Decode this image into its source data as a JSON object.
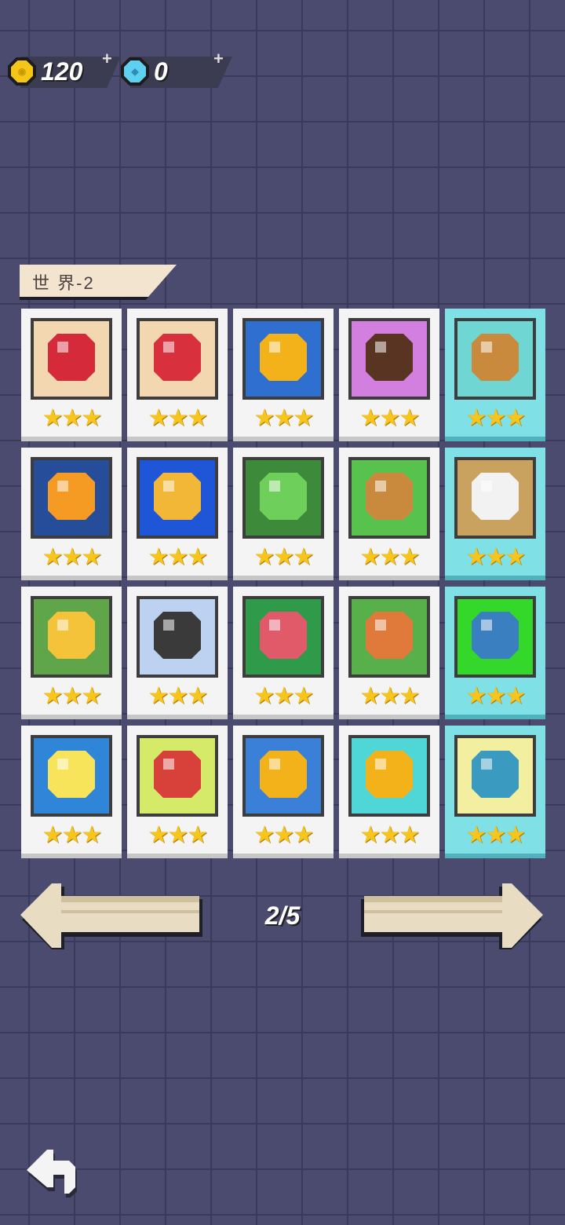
{
  "currency": {
    "coins": "120",
    "gems": "0",
    "coin_icon": "gold-coin-icon",
    "gem_icon": "blue-gem-icon",
    "add_label": "+"
  },
  "world": {
    "label": "世 界-2"
  },
  "levels": [
    {
      "icon": "red-gem-icon",
      "stars": "★★★",
      "special": false,
      "bg": "#f2d7b0",
      "fg": "#d42a3a"
    },
    {
      "icon": "meat-icon",
      "stars": "★★★",
      "special": false,
      "bg": "#f2d7b0",
      "fg": "#d8303d"
    },
    {
      "icon": "chick-icon",
      "stars": "★★★",
      "special": false,
      "bg": "#2f6fd0",
      "fg": "#f4b21a"
    },
    {
      "icon": "bear-icon",
      "stars": "★★★",
      "special": false,
      "bg": "#d37fe0",
      "fg": "#5a3422"
    },
    {
      "icon": "potato-icon",
      "stars": "★★★",
      "special": true,
      "bg": "#6fd6d4",
      "fg": "#c98a3e"
    },
    {
      "icon": "candle-icon",
      "stars": "★★★",
      "special": false,
      "bg": "#254d9a",
      "fg": "#f59a22"
    },
    {
      "icon": "bee-icon",
      "stars": "★★★",
      "special": false,
      "bg": "#1f56d8",
      "fg": "#f2b736"
    },
    {
      "icon": "frog-icon",
      "stars": "★★★",
      "special": false,
      "bg": "#3c8a3a",
      "fg": "#6fcf5b"
    },
    {
      "icon": "wooden-sign-icon",
      "stars": "★★★",
      "special": false,
      "bg": "#58c24f",
      "fg": "#c98a3e"
    },
    {
      "icon": "cow-icon",
      "stars": "★★★",
      "special": true,
      "bg": "#c9a25f",
      "fg": "#f2f2f2"
    },
    {
      "icon": "key-icon",
      "stars": "★★★",
      "special": false,
      "bg": "#5fa64a",
      "fg": "#f4c33a"
    },
    {
      "icon": "picture-frame-icon",
      "stars": "★★★",
      "special": false,
      "bg": "#bcd2f0",
      "fg": "#3a3a3a"
    },
    {
      "icon": "characters-icon",
      "stars": "★★★",
      "special": false,
      "bg": "#2f9b4a",
      "fg": "#e05a6a"
    },
    {
      "icon": "fox-icon",
      "stars": "★★★",
      "special": false,
      "bg": "#58b04a",
      "fg": "#e07a3a"
    },
    {
      "icon": "blue-creature-icon",
      "stars": "★★★",
      "special": true,
      "bg": "#34d82a",
      "fg": "#3a7fc0"
    },
    {
      "icon": "star-creature-icon",
      "stars": "★★★",
      "special": false,
      "bg": "#2f86d8",
      "fg": "#f7e45a"
    },
    {
      "icon": "strawberry-icon",
      "stars": "★★★",
      "special": false,
      "bg": "#d6ea6a",
      "fg": "#d8403a"
    },
    {
      "icon": "fish-icon",
      "stars": "★★★",
      "special": false,
      "bg": "#3a7fd8",
      "fg": "#f4b21a"
    },
    {
      "icon": "duck-icon",
      "stars": "★★★",
      "special": false,
      "bg": "#4fd6d6",
      "fg": "#f4b21a"
    },
    {
      "icon": "platypus-icon",
      "stars": "★★★",
      "special": true,
      "bg": "#f2f0a0",
      "fg": "#3a9ac0"
    }
  ],
  "pagination": {
    "page": "2/5",
    "prev_icon": "arrow-left-icon",
    "next_icon": "arrow-right-icon"
  },
  "back": {
    "icon": "back-arrow-icon"
  }
}
